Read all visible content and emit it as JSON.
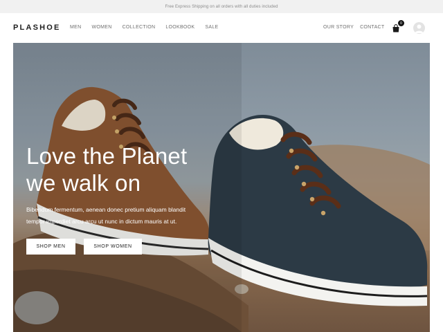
{
  "announcement": "Free Express Shipping on all orders with all duties included",
  "header": {
    "logo": "PLASHOE",
    "menu": [
      "MEN",
      "WOMEN",
      "COLLECTION",
      "LOOKBOOK",
      "SALE"
    ],
    "right_menu": [
      "OUR STORY",
      "CONTACT"
    ],
    "cart_count": "0",
    "icons": {
      "cart": "shopping-bag-icon",
      "account": "user-avatar-icon"
    }
  },
  "hero": {
    "title_line1": "Love the Planet",
    "title_line2": "we walk on",
    "text_line1": "Bibendum fermentum, aenean donec pretium aliquam blandit",
    "text_line2": "tempor imperdiet arcu arcu ut nunc in dictum mauris at ut.",
    "buttons": {
      "men": "SHOP MEN",
      "women": "SHOP WOMEN"
    }
  },
  "colors": {
    "text_dark": "#1d1d1d",
    "nav_text": "#6f6f6f",
    "announce_bg": "#f1f1f1"
  }
}
